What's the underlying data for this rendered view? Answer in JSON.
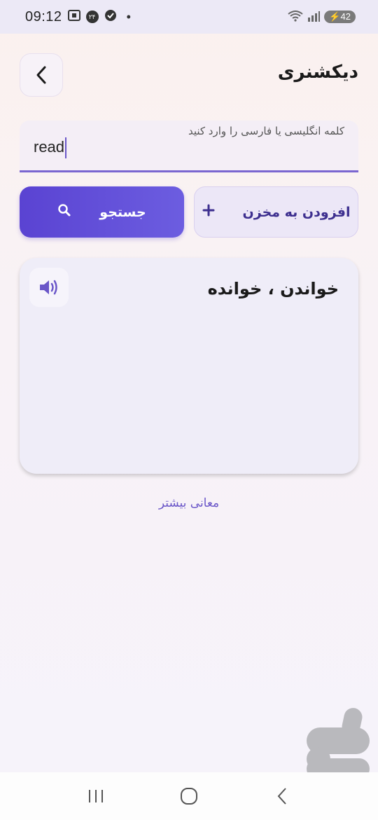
{
  "status_bar": {
    "time": "09:12",
    "badge_text": "۲۴",
    "battery": "42",
    "icons": [
      "screenshot-icon",
      "badge-icon",
      "shield-check-icon",
      "dot-icon",
      "wifi-icon",
      "signal-icon",
      "battery-icon"
    ]
  },
  "header": {
    "title": "دیکشنری",
    "back_icon": "chevron-left-icon"
  },
  "search": {
    "label": "کلمه انگلیسی یا فارسی را وارد کنید",
    "value": "read"
  },
  "buttons": {
    "search_label": "جستجو",
    "search_icon": "magnifier-icon",
    "add_label": "افزودن به مخزن",
    "add_icon": "plus-icon"
  },
  "result": {
    "meaning": "خواندن ، خوانده",
    "speak_icon": "speaker-icon"
  },
  "more_meanings": "معانی بیشتر",
  "nav": {
    "icons": [
      "recent-apps-icon",
      "home-icon",
      "back-icon"
    ]
  },
  "colors": {
    "accent": "#5a43d2",
    "accent_light": "#ece7f7",
    "card_bg": "#efedf8",
    "link": "#6a56c8"
  }
}
